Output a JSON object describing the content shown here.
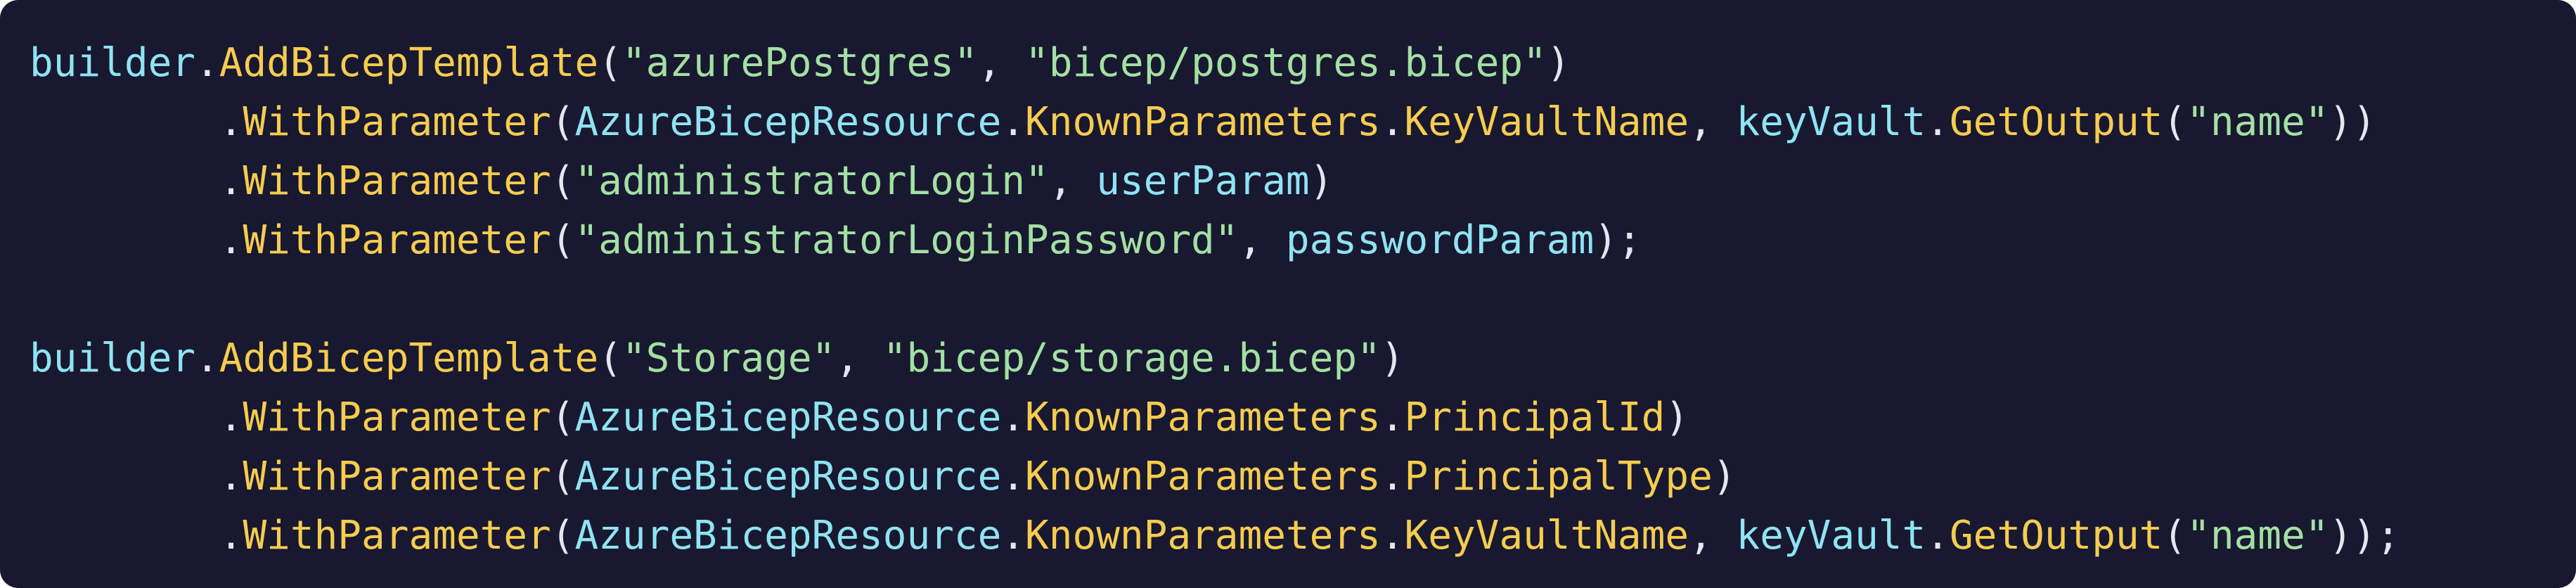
{
  "colors": {
    "background": "#181830",
    "identifier": "#8fe3f2",
    "method": "#f5cc4f",
    "string": "#a3e0a3",
    "punctuation": "#e6e6f0"
  },
  "code": {
    "lines": [
      [
        {
          "t": "builder",
          "c": "tok-cyan"
        },
        {
          "t": ".",
          "c": "tok-light"
        },
        {
          "t": "AddBicepTemplate",
          "c": "tok-yellow"
        },
        {
          "t": "(",
          "c": "tok-light"
        },
        {
          "t": "\"azurePostgres\"",
          "c": "tok-green"
        },
        {
          "t": ", ",
          "c": "tok-light"
        },
        {
          "t": "\"bicep/postgres.bicep\"",
          "c": "tok-green"
        },
        {
          "t": ")",
          "c": "tok-light"
        }
      ],
      [
        {
          "t": "        .",
          "c": "tok-light"
        },
        {
          "t": "WithParameter",
          "c": "tok-yellow"
        },
        {
          "t": "(",
          "c": "tok-light"
        },
        {
          "t": "AzureBicepResource",
          "c": "tok-cyan"
        },
        {
          "t": ".",
          "c": "tok-light"
        },
        {
          "t": "KnownParameters",
          "c": "tok-yellow"
        },
        {
          "t": ".",
          "c": "tok-light"
        },
        {
          "t": "KeyVaultName",
          "c": "tok-yellow"
        },
        {
          "t": ", ",
          "c": "tok-light"
        },
        {
          "t": "keyVault",
          "c": "tok-cyan"
        },
        {
          "t": ".",
          "c": "tok-light"
        },
        {
          "t": "GetOutput",
          "c": "tok-yellow"
        },
        {
          "t": "(",
          "c": "tok-light"
        },
        {
          "t": "\"name\"",
          "c": "tok-green"
        },
        {
          "t": "))",
          "c": "tok-light"
        }
      ],
      [
        {
          "t": "        .",
          "c": "tok-light"
        },
        {
          "t": "WithParameter",
          "c": "tok-yellow"
        },
        {
          "t": "(",
          "c": "tok-light"
        },
        {
          "t": "\"administratorLogin\"",
          "c": "tok-green"
        },
        {
          "t": ", ",
          "c": "tok-light"
        },
        {
          "t": "userParam",
          "c": "tok-cyan"
        },
        {
          "t": ")",
          "c": "tok-light"
        }
      ],
      [
        {
          "t": "        .",
          "c": "tok-light"
        },
        {
          "t": "WithParameter",
          "c": "tok-yellow"
        },
        {
          "t": "(",
          "c": "tok-light"
        },
        {
          "t": "\"administratorLoginPassword\"",
          "c": "tok-green"
        },
        {
          "t": ", ",
          "c": "tok-light"
        },
        {
          "t": "passwordParam",
          "c": "tok-cyan"
        },
        {
          "t": ");",
          "c": "tok-light"
        }
      ],
      [],
      [
        {
          "t": "builder",
          "c": "tok-cyan"
        },
        {
          "t": ".",
          "c": "tok-light"
        },
        {
          "t": "AddBicepTemplate",
          "c": "tok-yellow"
        },
        {
          "t": "(",
          "c": "tok-light"
        },
        {
          "t": "\"Storage\"",
          "c": "tok-green"
        },
        {
          "t": ", ",
          "c": "tok-light"
        },
        {
          "t": "\"bicep/storage.bicep\"",
          "c": "tok-green"
        },
        {
          "t": ")",
          "c": "tok-light"
        }
      ],
      [
        {
          "t": "        .",
          "c": "tok-light"
        },
        {
          "t": "WithParameter",
          "c": "tok-yellow"
        },
        {
          "t": "(",
          "c": "tok-light"
        },
        {
          "t": "AzureBicepResource",
          "c": "tok-cyan"
        },
        {
          "t": ".",
          "c": "tok-light"
        },
        {
          "t": "KnownParameters",
          "c": "tok-yellow"
        },
        {
          "t": ".",
          "c": "tok-light"
        },
        {
          "t": "PrincipalId",
          "c": "tok-yellow"
        },
        {
          "t": ")",
          "c": "tok-light"
        }
      ],
      [
        {
          "t": "        .",
          "c": "tok-light"
        },
        {
          "t": "WithParameter",
          "c": "tok-yellow"
        },
        {
          "t": "(",
          "c": "tok-light"
        },
        {
          "t": "AzureBicepResource",
          "c": "tok-cyan"
        },
        {
          "t": ".",
          "c": "tok-light"
        },
        {
          "t": "KnownParameters",
          "c": "tok-yellow"
        },
        {
          "t": ".",
          "c": "tok-light"
        },
        {
          "t": "PrincipalType",
          "c": "tok-yellow"
        },
        {
          "t": ")",
          "c": "tok-light"
        }
      ],
      [
        {
          "t": "        .",
          "c": "tok-light"
        },
        {
          "t": "WithParameter",
          "c": "tok-yellow"
        },
        {
          "t": "(",
          "c": "tok-light"
        },
        {
          "t": "AzureBicepResource",
          "c": "tok-cyan"
        },
        {
          "t": ".",
          "c": "tok-light"
        },
        {
          "t": "KnownParameters",
          "c": "tok-yellow"
        },
        {
          "t": ".",
          "c": "tok-light"
        },
        {
          "t": "KeyVaultName",
          "c": "tok-yellow"
        },
        {
          "t": ", ",
          "c": "tok-light"
        },
        {
          "t": "keyVault",
          "c": "tok-cyan"
        },
        {
          "t": ".",
          "c": "tok-light"
        },
        {
          "t": "GetOutput",
          "c": "tok-yellow"
        },
        {
          "t": "(",
          "c": "tok-light"
        },
        {
          "t": "\"name\"",
          "c": "tok-green"
        },
        {
          "t": "));",
          "c": "tok-light"
        }
      ]
    ]
  }
}
